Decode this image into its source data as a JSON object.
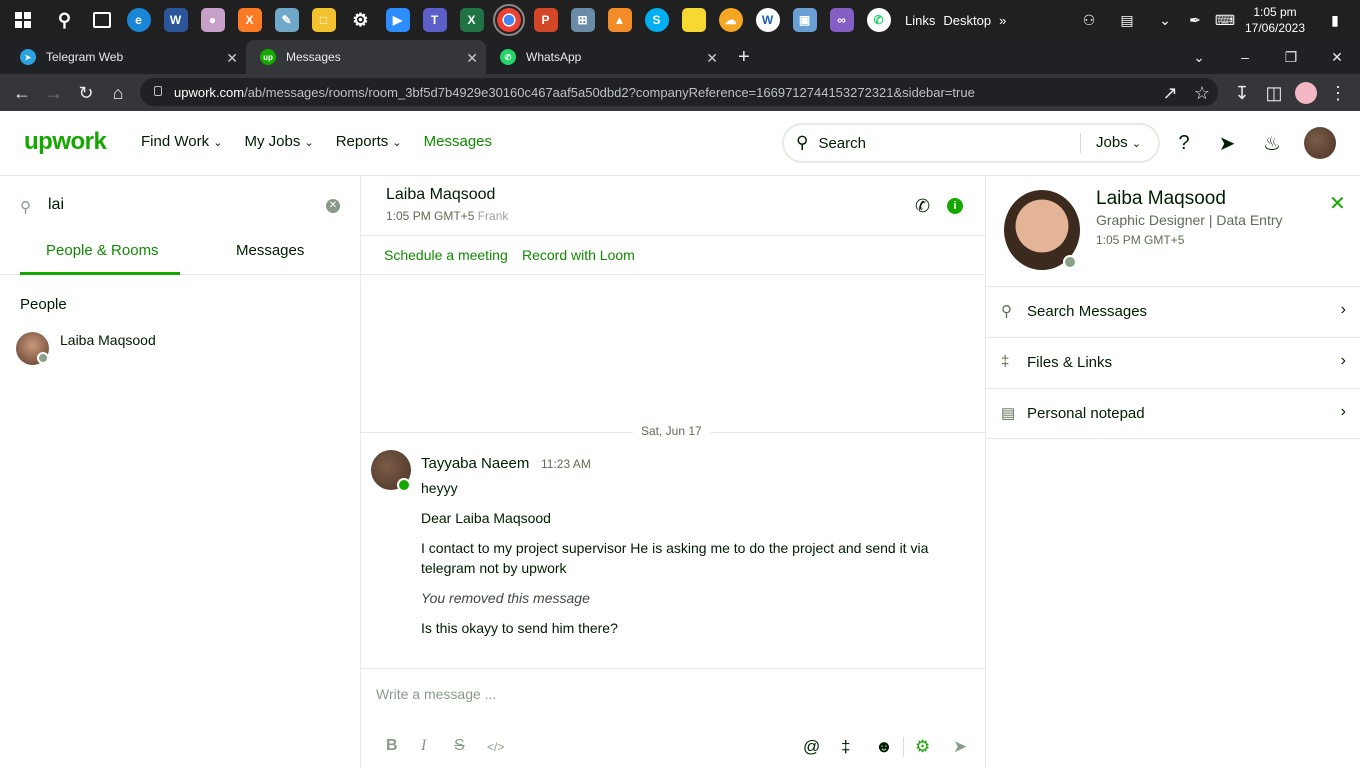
{
  "taskbar": {
    "links_label": "Links",
    "desktop_label": "Desktop",
    "time": "1:05 pm",
    "date": "17/06/2023"
  },
  "browser": {
    "tabs": [
      {
        "label": "Telegram Web",
        "icon": "telegram-icon"
      },
      {
        "label": "Messages",
        "icon": "upwork-icon"
      },
      {
        "label": "WhatsApp",
        "icon": "whatsapp-icon"
      }
    ],
    "url_host": "upwork.com",
    "url_path": "/ab/messages/rooms/room_3bf5d7b4929e30160c467aaf5a50dbd2?companyReference=1669712744153272321&sidebar=true"
  },
  "header": {
    "logo": "upwork",
    "nav": [
      "Find Work",
      "My Jobs",
      "Reports",
      "Messages"
    ],
    "search_placeholder": "Search",
    "search_scope": "Jobs"
  },
  "left": {
    "search_value": "lai",
    "tabs": [
      "People & Rooms",
      "Messages"
    ],
    "section": "People",
    "people": [
      {
        "name": "Laiba Maqsood"
      }
    ]
  },
  "chat": {
    "name": "Laiba Maqsood",
    "time": "1:05 PM GMT+5",
    "alias": "Frank",
    "actions": [
      "Schedule a meeting",
      "Record with Loom"
    ],
    "date_separator": "Sat, Jun 17",
    "message": {
      "sender": "Tayyaba Naeem",
      "time": "11:23 AM",
      "lines": [
        "heyyy",
        "Dear Laiba Maqsood",
        "I contact to my project supervisor He is asking me to do the project and send it via telegram not by upwork",
        "You removed this message",
        "Is this okayy to send him there?"
      ]
    },
    "composer_placeholder": "Write a message ..."
  },
  "profile": {
    "name": "Laiba Maqsood",
    "title": "Graphic Designer | Data Entry",
    "time": "1:05 PM GMT+5",
    "rows": [
      "Search Messages",
      "Files & Links",
      "Personal notepad"
    ]
  },
  "colors": {
    "brand": "#14a800",
    "link": "#108a00",
    "taskbar": "#202020"
  }
}
